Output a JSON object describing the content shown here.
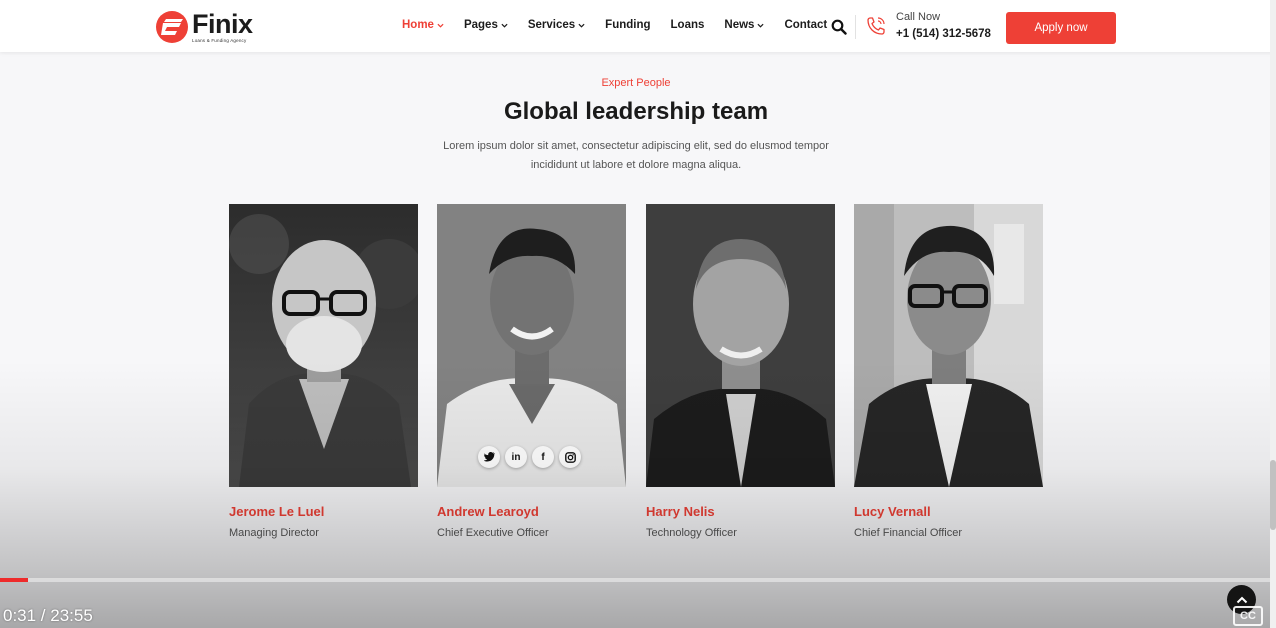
{
  "header": {
    "logo": {
      "name": "Finix",
      "tagline": "Loans & Funding Agency"
    },
    "nav": [
      {
        "label": "Home",
        "dropdown": true,
        "active": true
      },
      {
        "label": "Pages",
        "dropdown": true,
        "active": false
      },
      {
        "label": "Services",
        "dropdown": true,
        "active": false
      },
      {
        "label": "Funding",
        "dropdown": false,
        "active": false
      },
      {
        "label": "Loans",
        "dropdown": false,
        "active": false
      },
      {
        "label": "News",
        "dropdown": true,
        "active": false
      },
      {
        "label": "Contact",
        "dropdown": false,
        "active": false
      }
    ],
    "call_label": "Call Now",
    "call_number": "+1 (514) 312-5678",
    "apply_label": "Apply now",
    "icons": {
      "search": "search-icon",
      "phone": "phone-icon"
    }
  },
  "section": {
    "eyebrow": "Expert People",
    "title": "Global leadership team",
    "description": "Lorem ipsum dolor sit amet, consectetur adipiscing elit, sed do elusmod tempor incididunt ut labore et dolore magna aliqua."
  },
  "team": [
    {
      "name": "Jerome Le Luel",
      "role": "Managing Director"
    },
    {
      "name": "Andrew Learoyd",
      "role": "Chief Executive Officer"
    },
    {
      "name": "Harry Nelis",
      "role": "Technology Officer"
    },
    {
      "name": "Lucy Vernall",
      "role": "Chief Financial Officer"
    }
  ],
  "socials": [
    "twitter-icon",
    "linkedin-icon",
    "facebook-icon",
    "instagram-icon"
  ],
  "video": {
    "time": "0:31 / 23:55",
    "progress": 0.022,
    "cc_label": "CC"
  },
  "colors": {
    "accent": "#ee4036",
    "text": "#1a1a1a",
    "background": "#f7f7f9"
  }
}
